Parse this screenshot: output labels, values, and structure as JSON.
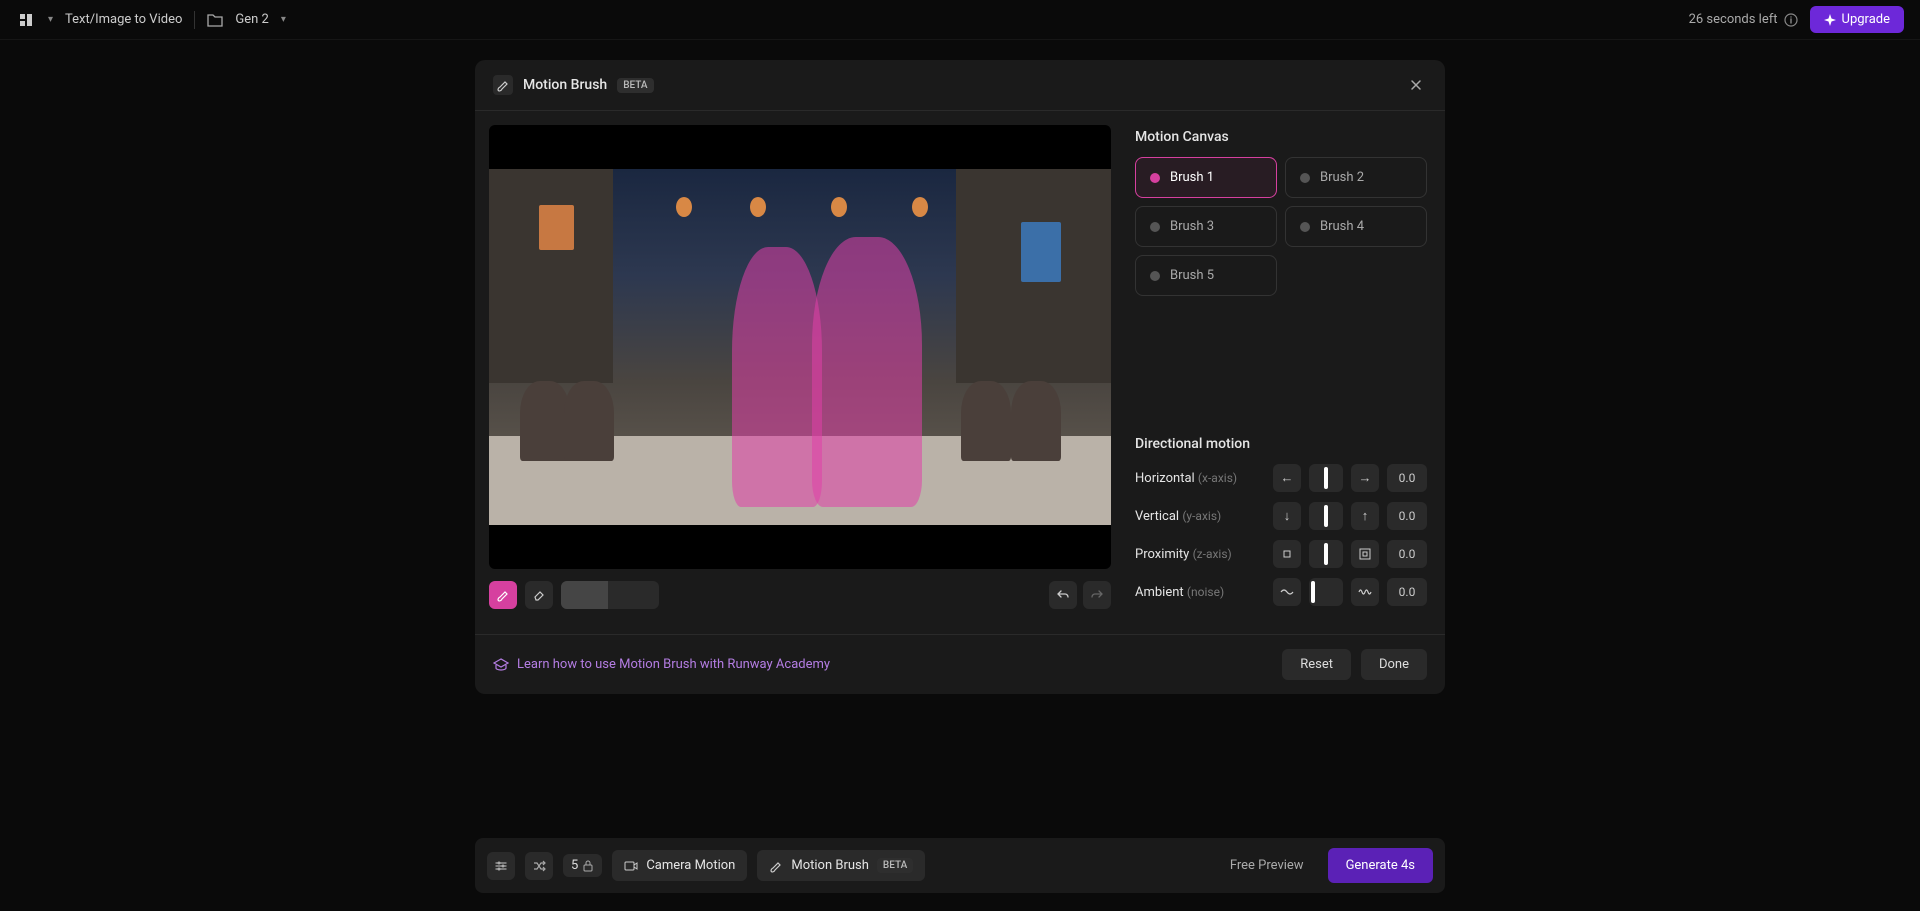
{
  "topbar": {
    "mode": "Text/Image to Video",
    "project": "Gen 2",
    "seconds_left": "26 seconds left",
    "upgrade": "Upgrade"
  },
  "modal": {
    "title": "Motion Brush",
    "beta": "BETA",
    "canvas_title": "Motion Canvas",
    "brushes": [
      "Brush 1",
      "Brush 2",
      "Brush 3",
      "Brush 4",
      "Brush 5"
    ],
    "directional_title": "Directional motion",
    "controls": {
      "horizontal": {
        "label": "Horizontal",
        "axis": "(x-axis)",
        "value": "0.0"
      },
      "vertical": {
        "label": "Vertical",
        "axis": "(y-axis)",
        "value": "0.0"
      },
      "proximity": {
        "label": "Proximity",
        "axis": "(z-axis)",
        "value": "0.0"
      },
      "ambient": {
        "label": "Ambient",
        "axis": "(noise)",
        "value": "0.0"
      }
    },
    "learn": "Learn how to use Motion Brush with Runway Academy",
    "reset": "Reset",
    "done": "Done"
  },
  "bottombar": {
    "seed": "5",
    "camera_motion": "Camera Motion",
    "motion_brush": "Motion Brush",
    "beta": "BETA",
    "free_preview": "Free Preview",
    "generate": "Generate 4s"
  }
}
